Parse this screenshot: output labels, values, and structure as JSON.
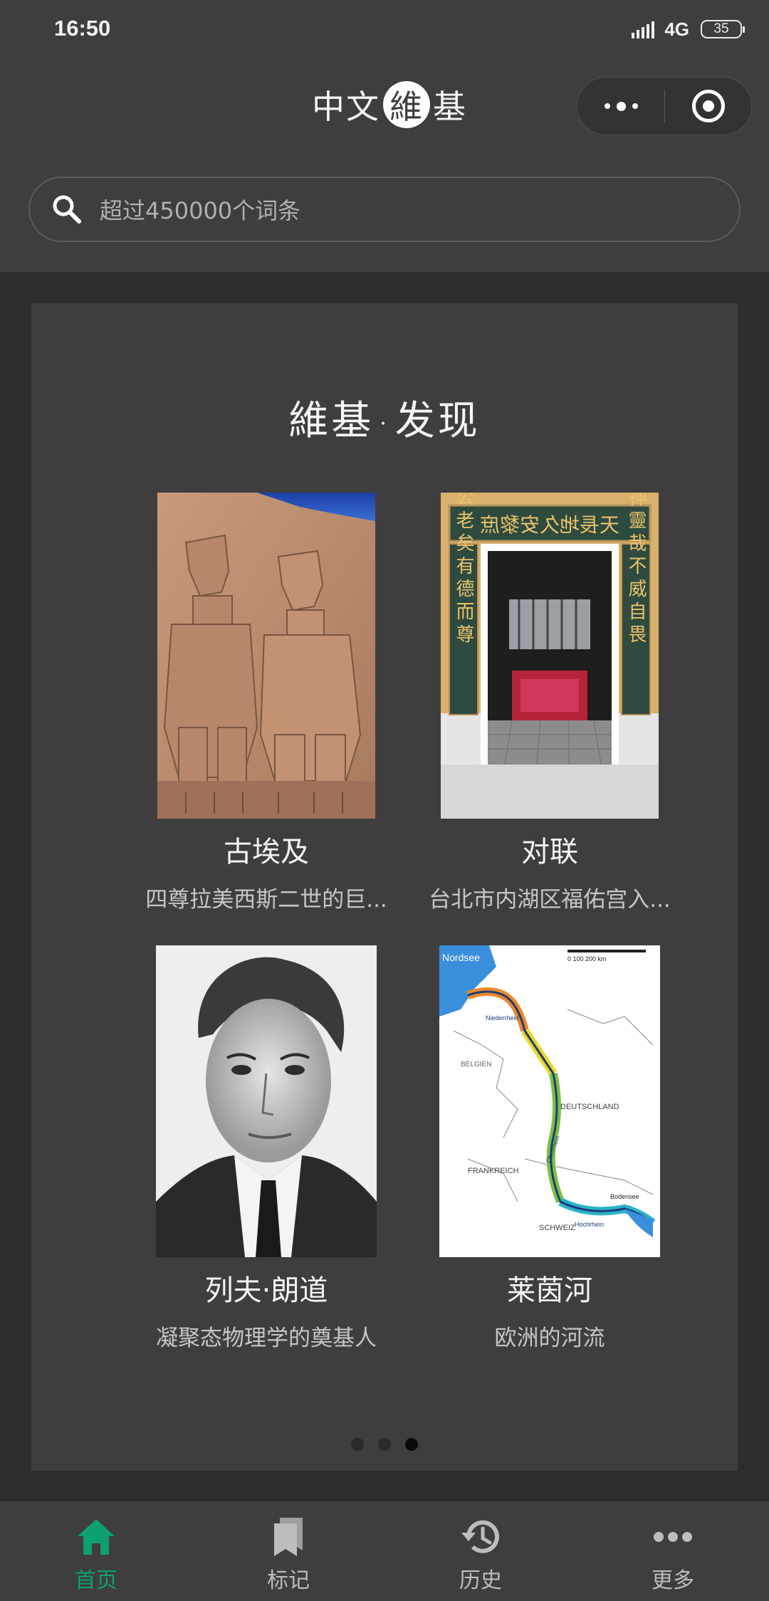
{
  "status_bar": {
    "time": "16:50",
    "network": "4G",
    "battery": "35"
  },
  "header": {
    "logo_left": "中文",
    "logo_circle": "維",
    "logo_right": "基"
  },
  "search": {
    "placeholder": "超过450000个词条"
  },
  "discover": {
    "title_left": "維基",
    "title_dot": "·",
    "title_right": "发现",
    "items": [
      {
        "name": "古埃及",
        "desc": "四尊拉美西斯二世的巨..."
      },
      {
        "name": "对联",
        "desc": "台北市内湖区福佑宫入..."
      },
      {
        "name": "列夫·朗道",
        "desc": "凝聚态物理学的奠基人"
      },
      {
        "name": "莱茵河",
        "desc": "欧洲的河流"
      }
    ],
    "page_count": 3,
    "active_page": 3
  },
  "couplet": {
    "top": "天長地久安黎庶",
    "left": "公老矣有德而尊",
    "right": "神靈哉不威自畏"
  },
  "map_labels": {
    "sea": "Nordsee",
    "scale": "0      100      200 km",
    "belgium": "BELGIEN",
    "germany": "DEUTSCHLAND",
    "france": "FRANKREICH",
    "swiss": "SCHWEIZ",
    "lake": "Bodensee",
    "lower": "Niederrhein",
    "upper": "Oberrhein",
    "high": "Hochrhein"
  },
  "tabs": [
    {
      "label": "首页",
      "icon": "home-icon",
      "active": true
    },
    {
      "label": "标记",
      "icon": "bookmark-icon",
      "active": false
    },
    {
      "label": "历史",
      "icon": "history-icon",
      "active": false
    },
    {
      "label": "更多",
      "icon": "more-icon",
      "active": false
    }
  ],
  "colors": {
    "accent": "#0e9f72",
    "header_bg": "#3e3e3e",
    "page_bg": "#2d2d2d"
  }
}
